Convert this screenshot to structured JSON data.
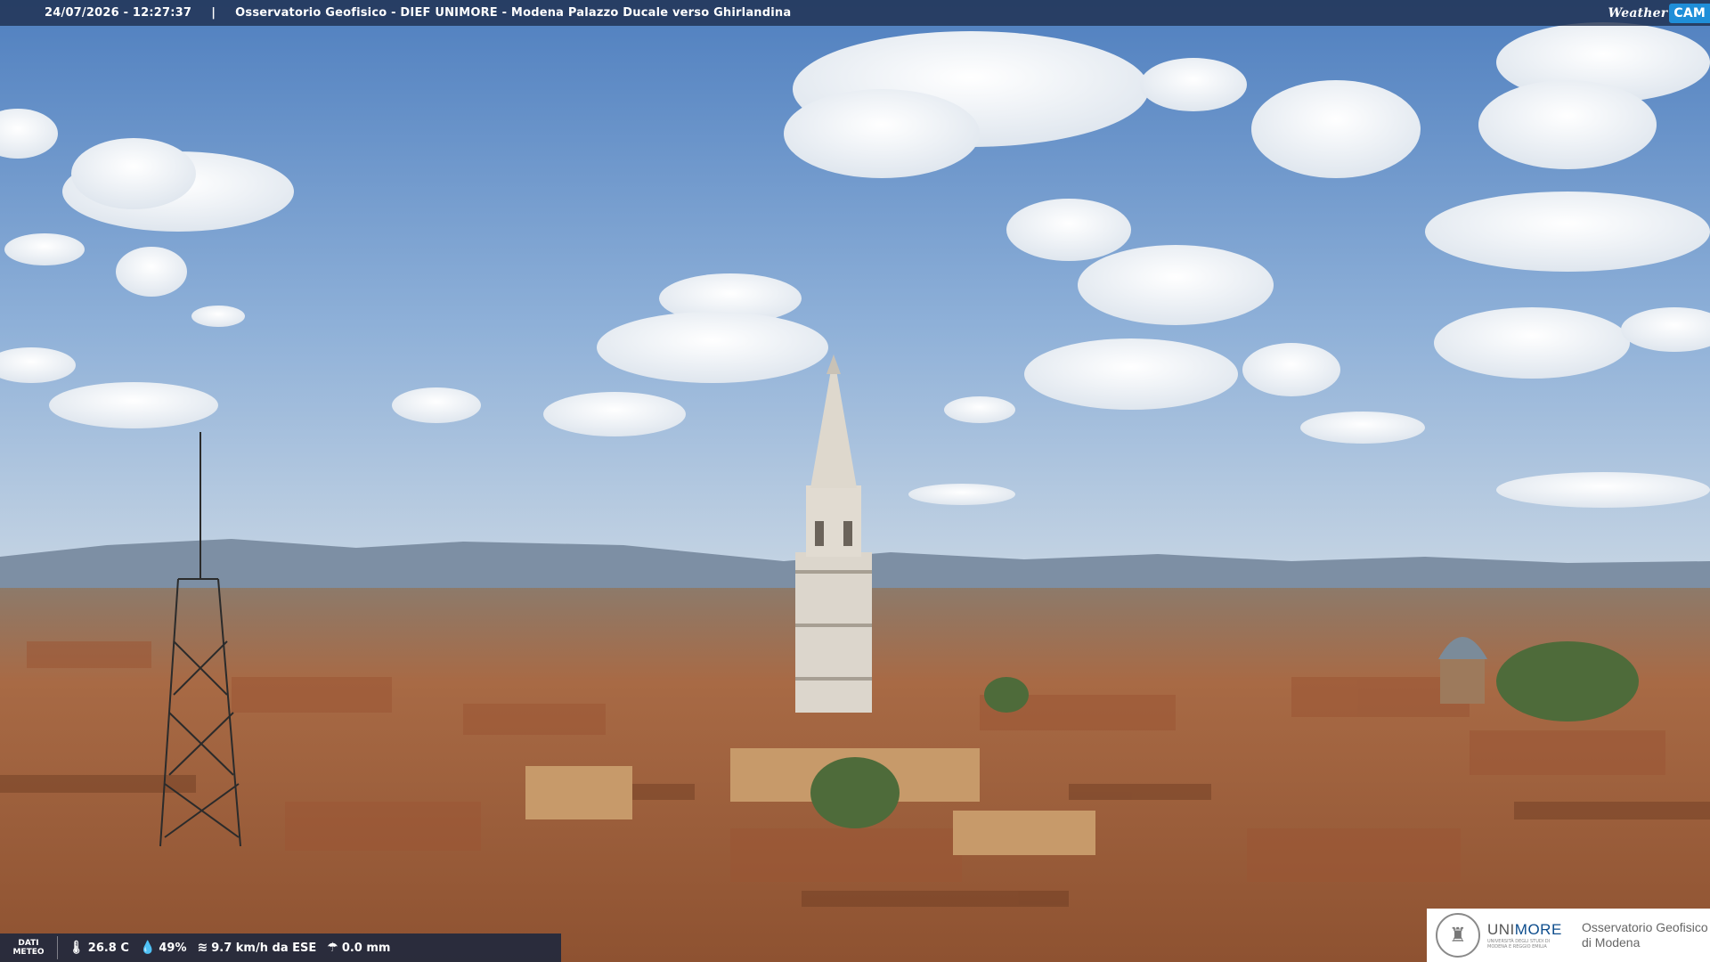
{
  "header": {
    "timestamp": "24/07/2026 - 12:27:37",
    "separator": "|",
    "title": "Osservatorio Geofisico - DIEF UNIMORE - Modena Palazzo Ducale verso Ghirlandina"
  },
  "brand_logo": {
    "weather": "Weather",
    "cam": "CAM"
  },
  "meteo": {
    "label_line1": "DATI",
    "label_line2": "METEO",
    "temperature": "26.8 C",
    "humidity": "49%",
    "wind": "9.7 km/h da ESE",
    "rain": "0.0 mm",
    "icons": [
      "thermometer-icon",
      "humidity-drop-icon",
      "wind-icon",
      "rain-icon"
    ]
  },
  "unimore": {
    "uni": "UNI",
    "more": "MORE",
    "subtitle": "UNIVERSITÀ DEGLI STUDI DI MODENA E REGGIO EMILIA",
    "observatory_line1": "Osservatorio Geofisico",
    "observatory_line2": "di Modena"
  },
  "colors": {
    "sky_top": "#5b88c4",
    "sky_horizon": "#b9cde3",
    "roofs": "#b9714a",
    "brand_blue": "#1f8ed8"
  }
}
